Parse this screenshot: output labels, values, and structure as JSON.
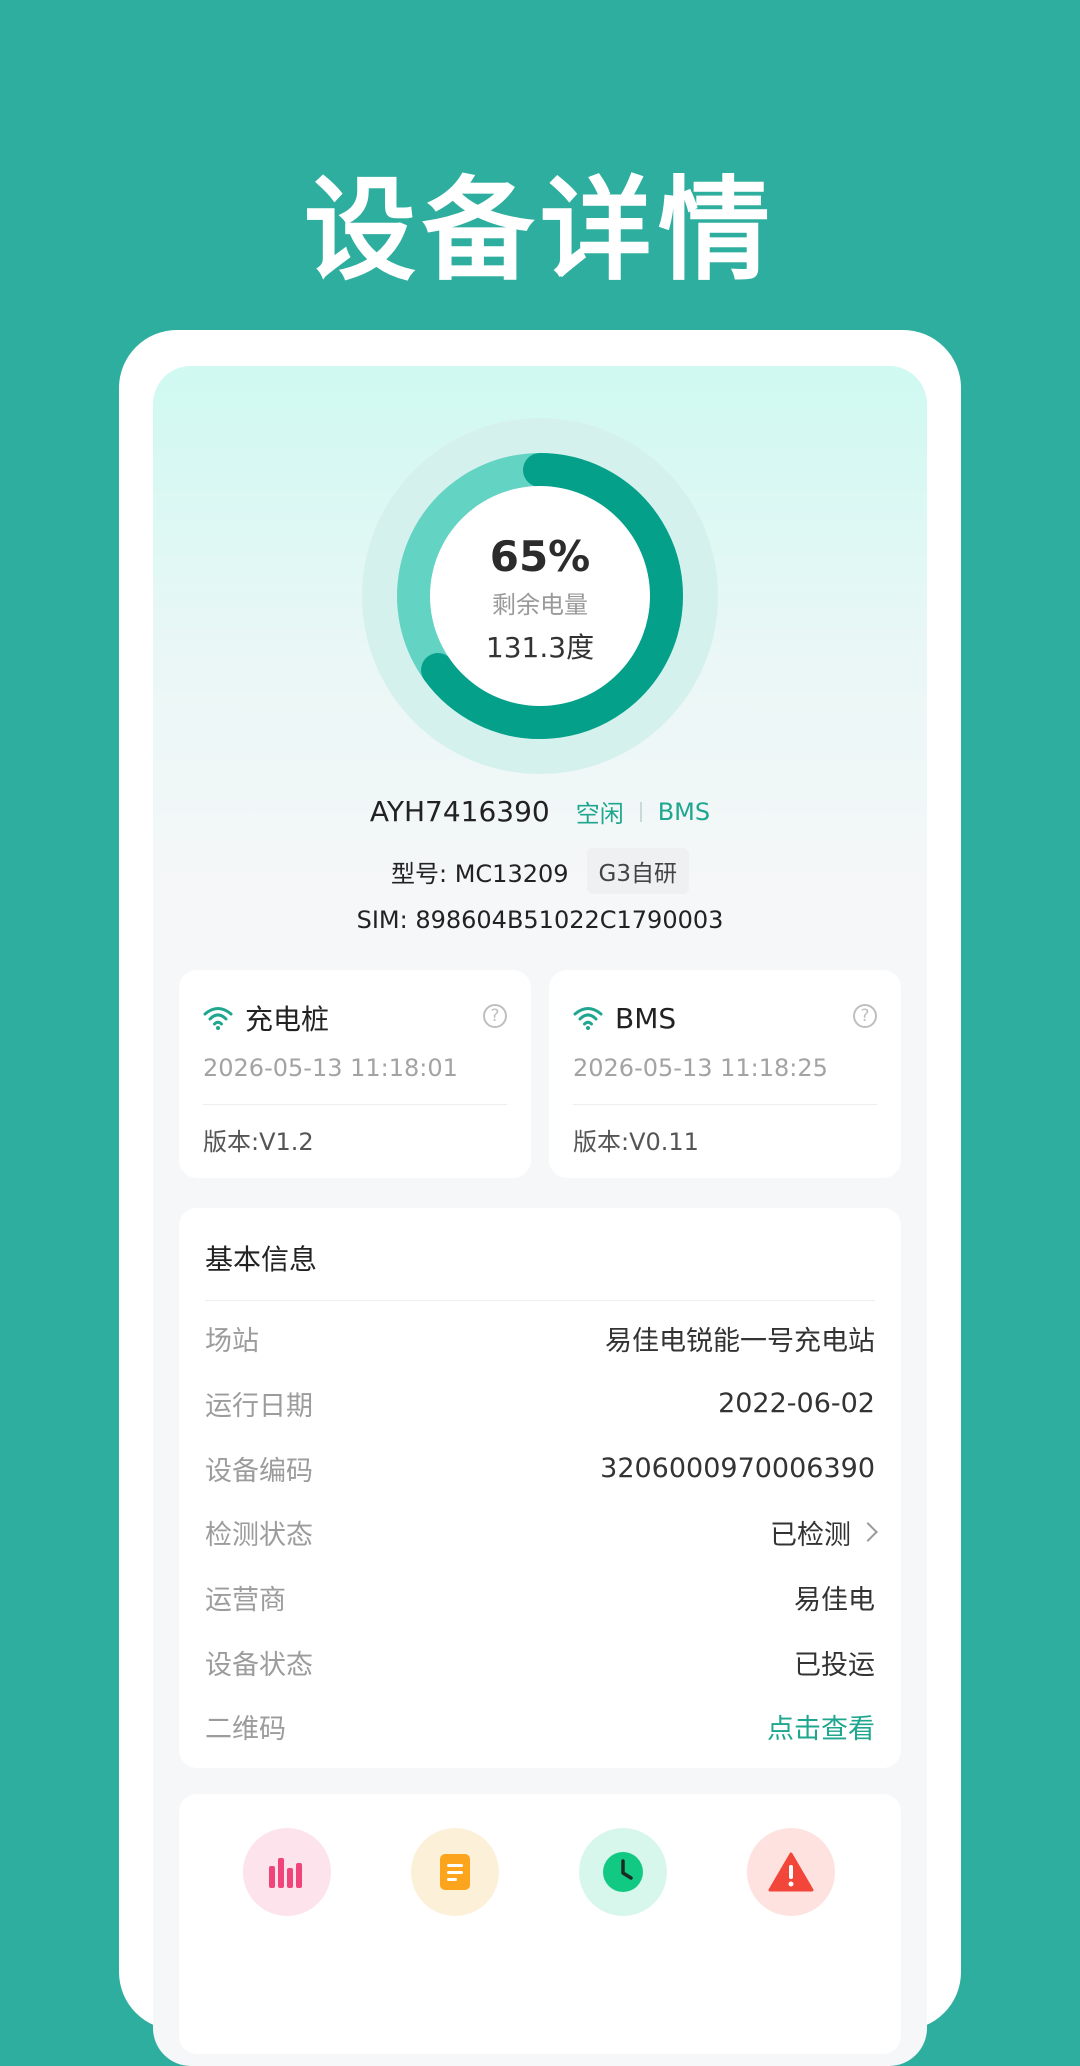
{
  "header": {
    "title": "设备详情"
  },
  "gauge": {
    "percent_text": "65%",
    "percent_value": 0.65,
    "label": "剩余电量",
    "value_text": "131.3度",
    "colors": {
      "outer": "#D5F1EE",
      "track": "#63D3C3",
      "progress": "#05A08A",
      "center": "#FFFFFF"
    }
  },
  "device": {
    "id": "AYH7416390",
    "status": "空闲",
    "link": "BMS",
    "model_label": "型号: MC13209",
    "model_tag": "G3自研",
    "sim": "SIM: 898604B51022C1790003"
  },
  "comm_cards": [
    {
      "title": "充电桩",
      "help": "?",
      "time": "2026-05-13 11:18:01",
      "version": "版本:V1.2"
    },
    {
      "title": "BMS",
      "help": "?",
      "time": "2026-05-13 11:18:25",
      "version": "版本:V0.11"
    }
  ],
  "basic_info": {
    "title": "基本信息",
    "rows": [
      {
        "key": "场站",
        "value": "易佳电锐能一号充电站"
      },
      {
        "key": "运行日期",
        "value": "2022-06-02"
      },
      {
        "key": "设备编码",
        "value": "3206000970006390"
      },
      {
        "key": "检测状态",
        "value": "已检测"
      },
      {
        "key": "运营商",
        "value": "易佳电"
      },
      {
        "key": "设备状态",
        "value": "已投运"
      },
      {
        "key": "二维码",
        "value": "点击查看"
      }
    ]
  },
  "functions": {
    "icons": [
      {
        "name": "bar-chart-icon",
        "bg": "#FDE3EC",
        "fg": "#F0457A"
      },
      {
        "name": "document-icon",
        "bg": "#FDF0D8",
        "fg": "#FCA51C"
      },
      {
        "name": "clock-icon",
        "bg": "#D8F7EC",
        "fg": "#11C983"
      },
      {
        "name": "warning-icon",
        "bg": "#FDE2DF",
        "fg": "#F2463B"
      }
    ]
  },
  "colors": {
    "brand": "#2EAE9E",
    "accent": "#1FA68F"
  }
}
